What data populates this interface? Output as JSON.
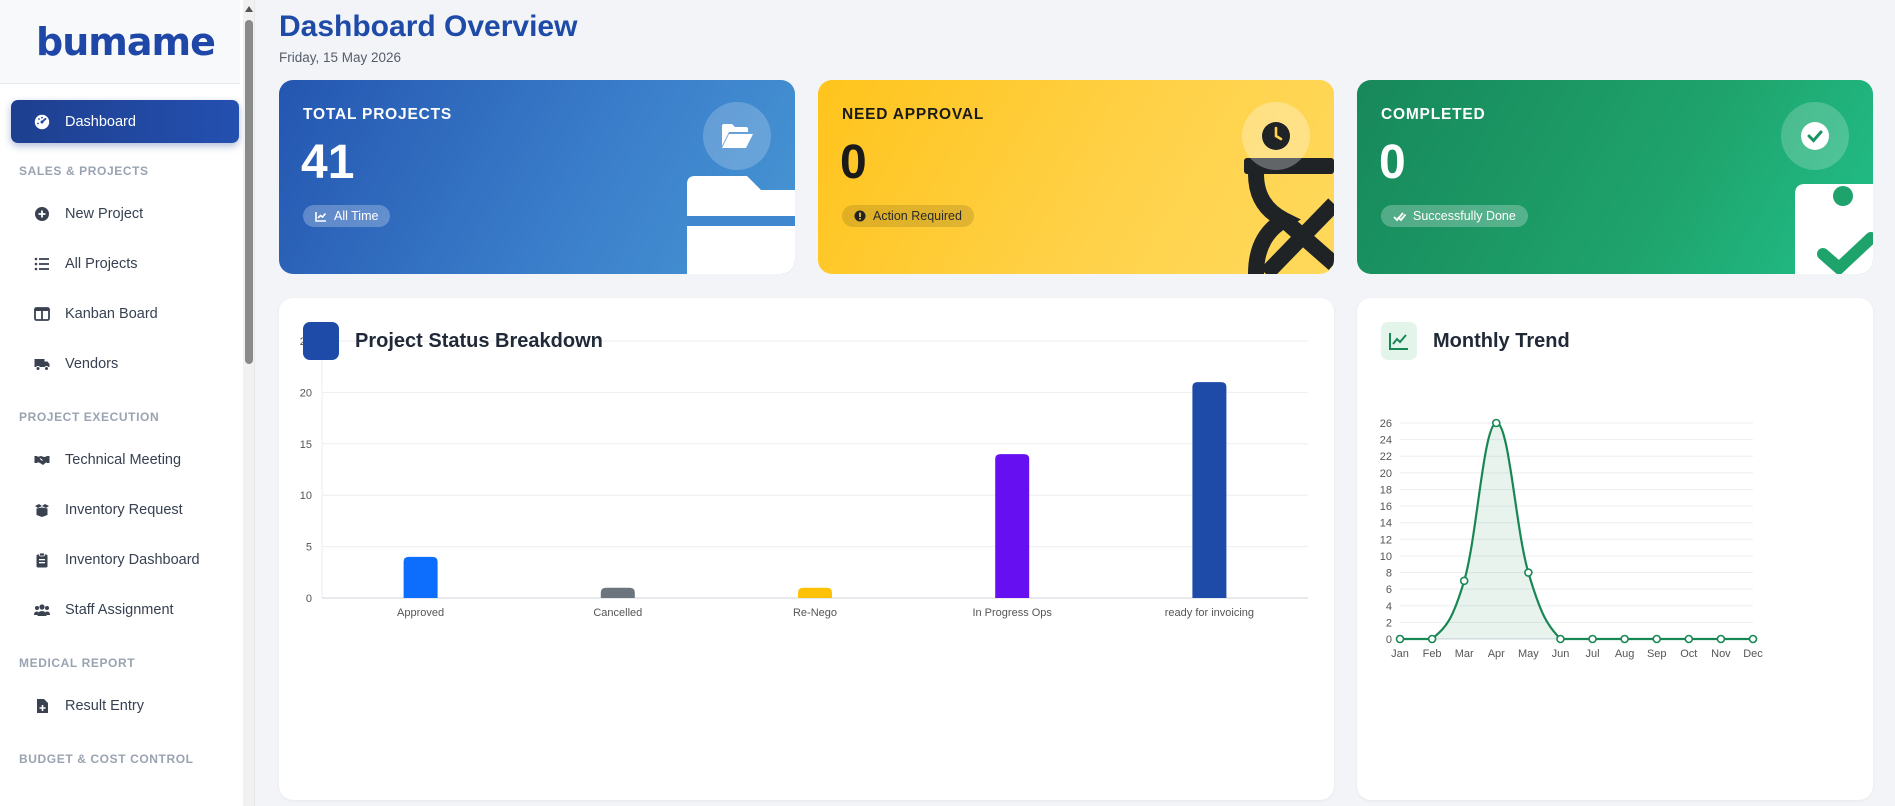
{
  "app": {
    "logo": "bumame"
  },
  "sidebar": {
    "active_item": {
      "label": "Dashboard",
      "icon": "gauge-icon"
    },
    "groups": [
      {
        "title": "",
        "items": []
      },
      {
        "title": "SALES & PROJECTS",
        "items": [
          {
            "label": "New Project",
            "icon": "plus-circle-icon"
          },
          {
            "label": "All Projects",
            "icon": "list-icon"
          },
          {
            "label": "Kanban Board",
            "icon": "columns-icon"
          },
          {
            "label": "Vendors",
            "icon": "truck-icon"
          }
        ]
      },
      {
        "title": "PROJECT EXECUTION",
        "items": [
          {
            "label": "Technical Meeting",
            "icon": "handshake-icon"
          },
          {
            "label": "Inventory Request",
            "icon": "box-open-icon"
          },
          {
            "label": "Inventory Dashboard",
            "icon": "clipboard-icon"
          },
          {
            "label": "Staff Assignment",
            "icon": "users-icon"
          }
        ]
      },
      {
        "title": "MEDICAL REPORT",
        "items": [
          {
            "label": "Result Entry",
            "icon": "file-medical-icon"
          }
        ]
      },
      {
        "title": "BUDGET & COST CONTROL",
        "items": []
      }
    ]
  },
  "header": {
    "title": "Dashboard Overview",
    "date": "Friday, 15 May 2026"
  },
  "stats": [
    {
      "label": "TOTAL PROJECTS",
      "value": "41",
      "badge": "All Time",
      "icon": "folder-open-icon",
      "color": "#2456b0"
    },
    {
      "label": "NEED APPROVAL",
      "value": "0",
      "badge": "Action Required",
      "icon": "clock-icon",
      "color": "#ffc41c"
    },
    {
      "label": "COMPLETED",
      "value": "0",
      "badge": "Successfully Done",
      "icon": "check-circle-icon",
      "color": "#17885a"
    }
  ],
  "panels": {
    "status": {
      "title": "Project Status Breakdown",
      "icon": "square-icon"
    },
    "trend": {
      "title": "Monthly Trend",
      "icon": "line-chart-icon"
    }
  },
  "chart_data": [
    {
      "type": "bar",
      "title": "Project Status Breakdown",
      "categories": [
        "Approved",
        "Cancelled",
        "Re-Nego",
        "In Progress Ops",
        "ready for invoicing"
      ],
      "values": [
        4,
        1,
        1,
        14,
        21
      ],
      "colors": [
        "#0d6efd",
        "#6c757d",
        "#ffc107",
        "#6610f2",
        "#1e4aa8"
      ],
      "ylim": [
        0,
        25
      ],
      "yticks": [
        0,
        5,
        10,
        15,
        20,
        25
      ],
      "grid": true
    },
    {
      "type": "area",
      "title": "Monthly Trend",
      "x": [
        "Jan",
        "Feb",
        "Mar",
        "Apr",
        "May",
        "Jun",
        "Jul",
        "Aug",
        "Sep",
        "Oct",
        "Nov",
        "Dec"
      ],
      "values": [
        0,
        0,
        7,
        26,
        8,
        0,
        0,
        0,
        0,
        0,
        0,
        0
      ],
      "color": "#198754",
      "ylim": [
        0,
        26
      ],
      "yticks": [
        0,
        2,
        4,
        6,
        8,
        10,
        12,
        14,
        16,
        18,
        20,
        22,
        24,
        26
      ],
      "grid": true
    }
  ]
}
